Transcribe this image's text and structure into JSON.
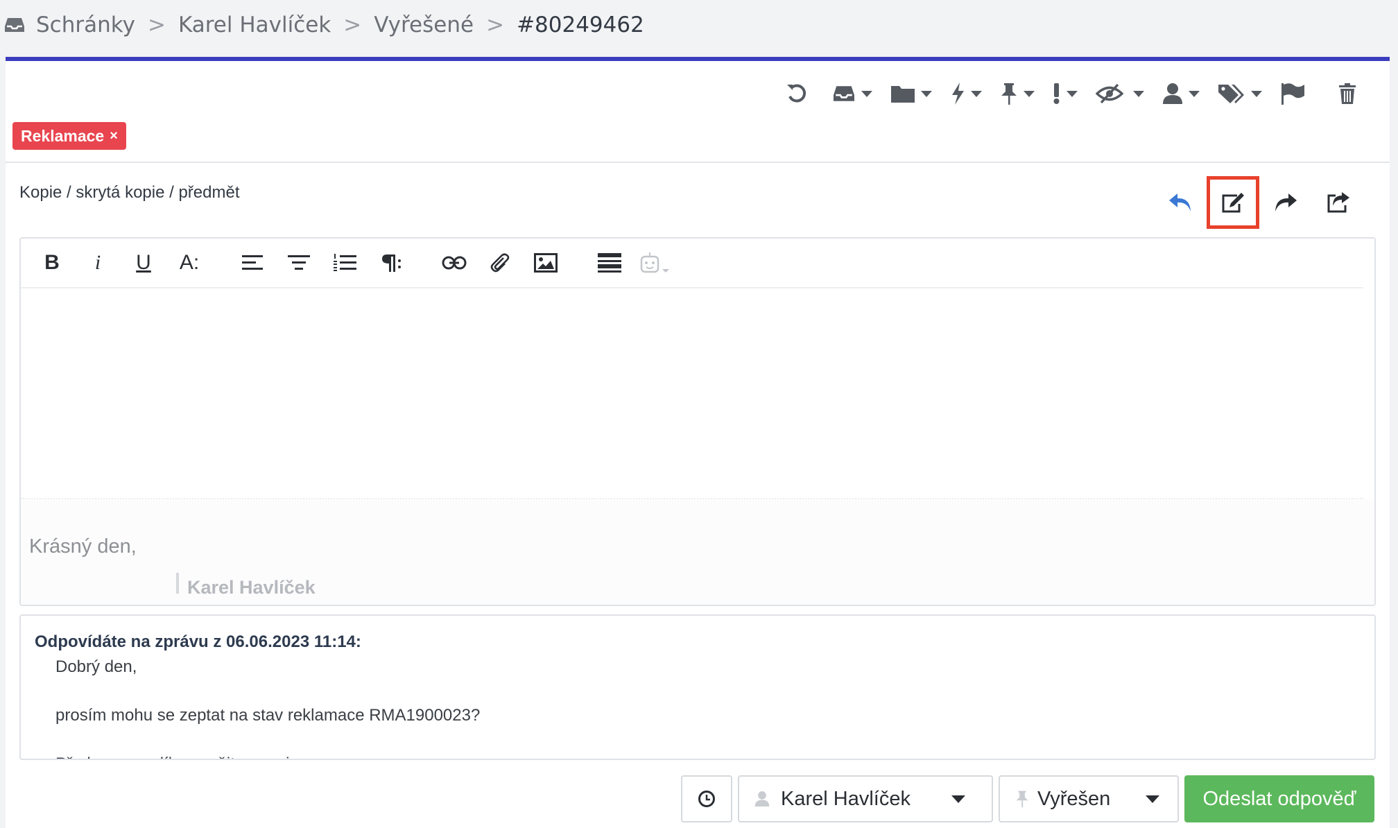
{
  "breadcrumb": {
    "icon": "inbox-icon",
    "items": [
      "Schránky",
      "Karel Havlíček",
      "Vyřešené"
    ],
    "separator": ">",
    "current": "#80249462"
  },
  "toolbar": {
    "icons": [
      "undo-icon",
      "inbox-icon",
      "folder-icon",
      "bolt-icon",
      "pin-icon",
      "exclamation-icon",
      "eye-slash-icon",
      "user-icon",
      "tags-icon",
      "flag-icon",
      "trash-icon"
    ]
  },
  "tag": {
    "label": "Reklamace",
    "remove": "×",
    "color": "#e8454f"
  },
  "fields_link": "Kopie / skrytá kopie / předmět",
  "reply_actions": {
    "icons": [
      "reply-icon",
      "edit-note-icon",
      "forward-icon",
      "share-icon"
    ],
    "active": "edit-note-icon"
  },
  "editor": {
    "toolbar": [
      "B",
      "i",
      "U",
      "A:",
      "align-left-icon",
      "align-center-icon",
      "ordered-list-icon",
      "paragraph-icon",
      "link-icon",
      "paperclip-icon",
      "image-icon",
      "template-icon",
      "bot-icon"
    ],
    "signature_greeting": "Krásný den,",
    "signature_name": "Karel Havlíček"
  },
  "quote": {
    "header": "Odpovídáte na zprávu z 06.06.2023 11:14:",
    "lines": [
      "Dobrý den,",
      "",
      "prosím mohu se zeptat na stav reklamace RMA1900023?",
      "",
      "Předem moc díky a mějte se prima"
    ]
  },
  "footer": {
    "assignee": "Karel Havlíček",
    "status": "Vyřešen",
    "send_label": "Odeslat odpověď",
    "send_color": "#5cb85c"
  },
  "colors": {
    "accent": "#3b3dbf",
    "highlight": "#e8412c",
    "reply_blue": "#3a78d4"
  }
}
